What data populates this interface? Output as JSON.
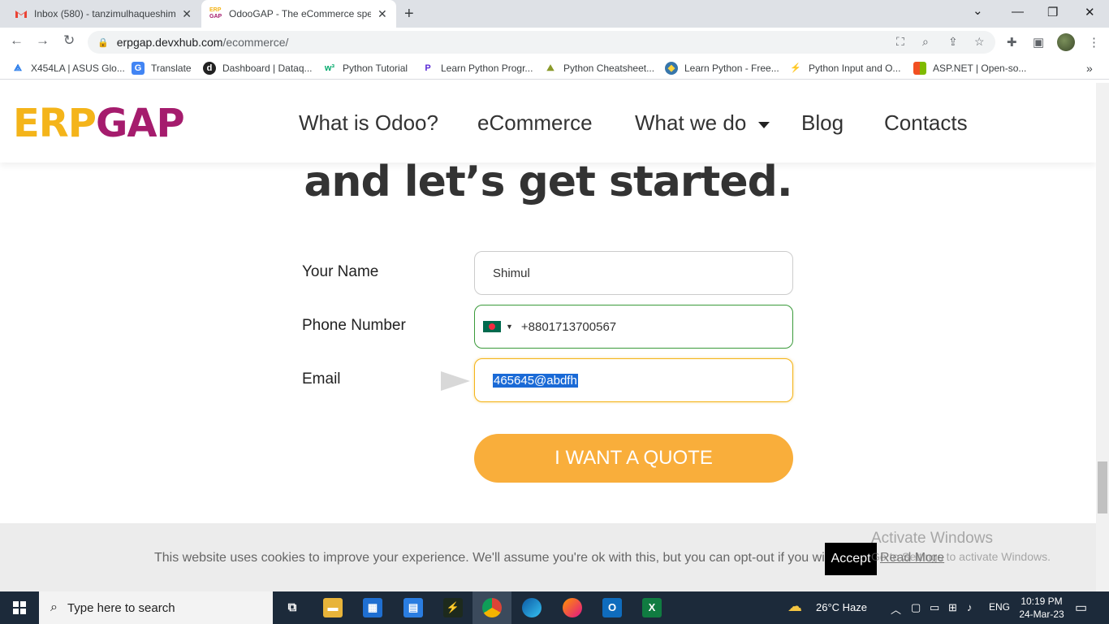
{
  "browser": {
    "tabs": [
      {
        "title": "Inbox (580) - tanzimulhaqueshim",
        "active": false
      },
      {
        "title": "OdooGAP - The eCommerce spe",
        "active": true
      }
    ],
    "url_host": "erpgap.devxhub.com",
    "url_path": "/ecommerce/",
    "bookmarks": [
      "X454LA | ASUS Glo...",
      "Translate",
      "Dashboard | Dataq...",
      "Python Tutorial",
      "Learn Python Progr...",
      "Python Cheatsheet...",
      "Learn Python - Free...",
      "Python Input and O...",
      "ASP.NET | Open-so..."
    ]
  },
  "site": {
    "logo_erp": "ERP",
    "logo_gap": "GAP",
    "nav": [
      "What is Odoo?",
      "eCommerce",
      "What we do",
      "Blog",
      "Contacts"
    ],
    "hero": "and let’s get started."
  },
  "form": {
    "name_label": "Your Name",
    "name_value": "Shimul",
    "phone_label": "Phone Number",
    "phone_value": "+8801713700567",
    "email_label": "Email",
    "email_value": "465645@abdfh",
    "submit_label": "I WANT A QUOTE"
  },
  "cookie": {
    "text": "This website uses cookies to improve your experience. We'll assume you're ok with this, but you can opt-out if you wish.",
    "accept": "Accept",
    "read_more": "Read More"
  },
  "watermark": {
    "line1": "Activate Windows",
    "line2": "Go to Settings to activate Windows."
  },
  "taskbar": {
    "search_placeholder": "Type here to search",
    "weather": "26°C  Haze",
    "lang": "ENG",
    "time": "10:19 PM",
    "date": "24-Mar-23"
  },
  "colors": {
    "logo_yellow": "#f4b41a",
    "logo_magenta": "#a51c6d",
    "quote_button": "#f9ae3b"
  }
}
